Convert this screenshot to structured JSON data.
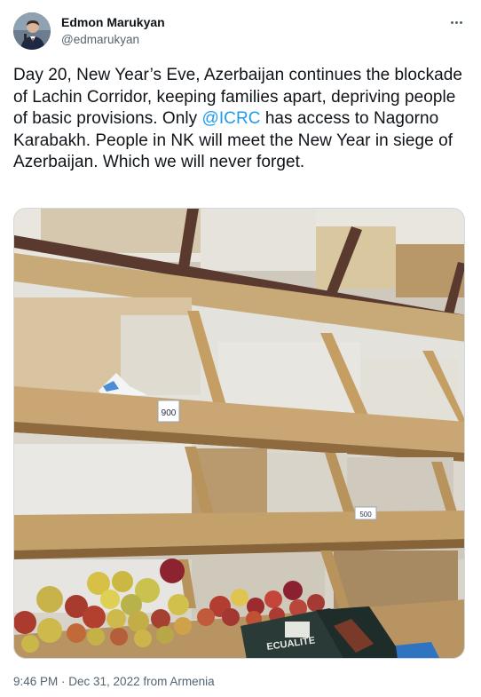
{
  "author": {
    "display_name": "Edmon Marukyan",
    "handle": "@edmarukyan"
  },
  "tweet": {
    "text_before_mention": "Day 20, New Year’s Eve, Azerbaijan continues the blockade of Lachin Corridor, keeping families apart, depriving people of basic provisions. Only ",
    "mention": "@ICRC",
    "text_after_mention": " has access to Nagorno Karabakh. People in NK will meet the New Year in siege of Azerbaijan. Which we will never forget."
  },
  "media": {
    "price_tags": [
      "900",
      "500"
    ],
    "box_label": "ECUALITE"
  },
  "meta": {
    "timestamp": "9:46 PM · Dec 31, 2022 from Armenia"
  },
  "icons": {
    "more": "more-horizontal-icon",
    "avatar": "avatar"
  }
}
